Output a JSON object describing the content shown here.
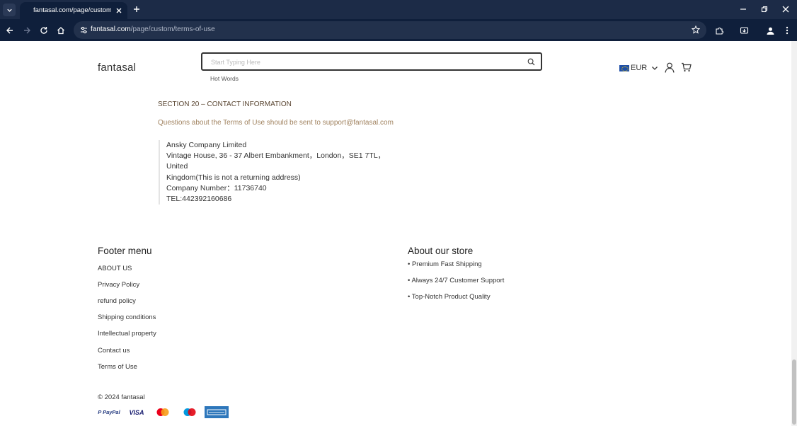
{
  "browser": {
    "tab_title": "fantasal.com/page/custom/terms-of-use",
    "url_host": "fantasal.com",
    "url_path": "/page/custom/terms-of-use"
  },
  "header": {
    "logo": "fantasal",
    "search_placeholder": "Start Typing Here",
    "hot_words": "Hot Words",
    "currency": "EUR"
  },
  "content": {
    "section_heading": "SECTION 20 – CONTACT INFORMATION",
    "contact_line": "Questions about the Terms of Use should be sent to support@fantasal.com",
    "address": [
      "Ansky Company Limited",
      "Vintage House, 36 - 37 Albert Embankment，London，SE1 7TL，United",
      "Kingdom(This is not a returning address)",
      "Company Number：11736740",
      "TEL:442392160686"
    ]
  },
  "footer": {
    "menu_title": "Footer menu",
    "menu_links": [
      "ABOUT US",
      "Privacy Policy",
      "refund policy",
      "Shipping conditions",
      "Intellectual property",
      "Contact us",
      "Terms of Use"
    ],
    "store_title": "About our store",
    "store_items": [
      "• Premium Fast Shipping",
      "• Always 24/7 Customer Support",
      "• Top-Notch Product Quality"
    ],
    "copyright": "© 2024 fantasal",
    "payment_icons": {
      "paypal_a": "P PayPal",
      "visa": "VISA"
    }
  },
  "colors": {
    "chrome_dark": "#0f1f3b",
    "chrome_tabstrip": "#1c2b47",
    "heading_brown": "#5a4632",
    "link_tan": "#a0825f"
  }
}
